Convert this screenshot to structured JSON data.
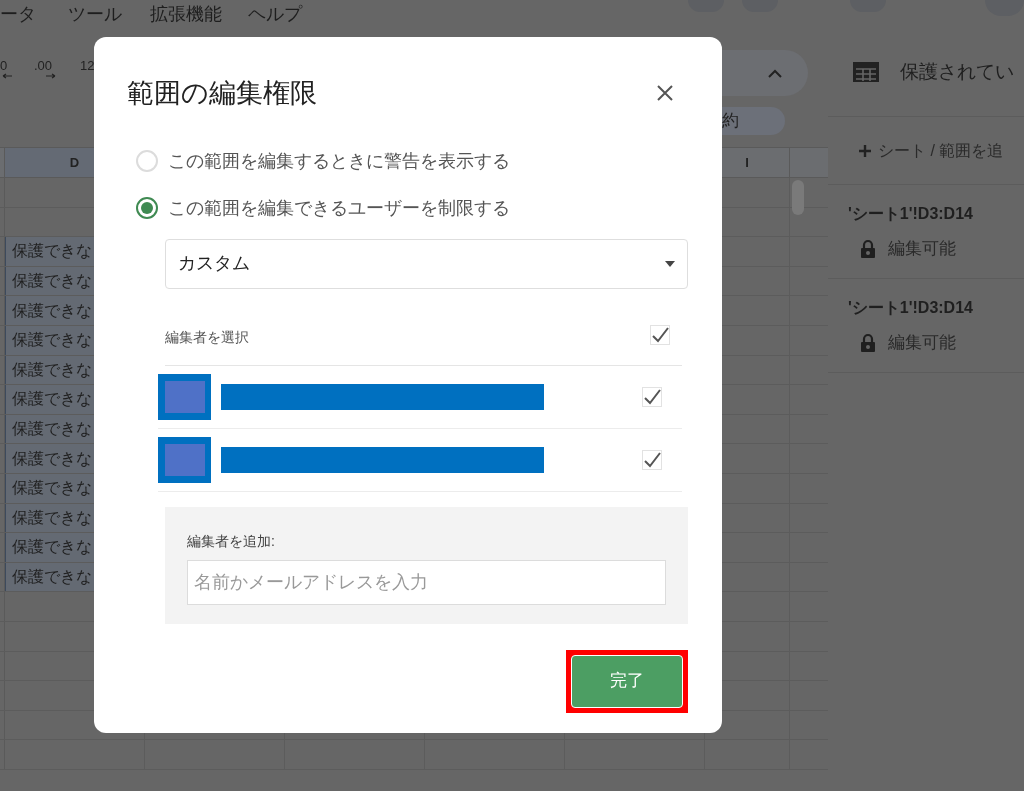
{
  "menu": [
    "ータ",
    "ツール",
    "拡張機能",
    "ヘルプ"
  ],
  "toolbar": {
    "items": [
      "0",
      ".00",
      "12"
    ],
    "summary": "約"
  },
  "sheet": {
    "columns": [
      {
        "label": "D"
      },
      {},
      {},
      {},
      {},
      {
        "label": "I"
      }
    ],
    "cells": [
      "保護できな",
      "保護できな",
      "保護できな",
      "保護できな",
      "保護できな",
      "保護できな",
      "保護できな",
      "保護できな",
      "保護できな",
      "保護できな",
      "保護できな",
      "保護できな"
    ]
  },
  "panel": {
    "title": "保護されてい",
    "add_label": "シート / 範囲を追",
    "ranges": [
      {
        "range": "'シート1'!D3:D14",
        "permission": "編集可能"
      },
      {
        "range": "'シート1'!D3:D14",
        "permission": "編集可能"
      }
    ]
  },
  "dialog": {
    "title": "範囲の編集権限",
    "options": [
      {
        "label": "この範囲を編集するときに警告を表示する",
        "selected": false
      },
      {
        "label": "この範囲を編集できるユーザーを制限する",
        "selected": true
      }
    ],
    "dropdown": {
      "value": "カスタム"
    },
    "select_editors": {
      "label": "編集者を選択",
      "checked": true
    },
    "editors": [
      {
        "checked": true
      },
      {
        "checked": true
      }
    ],
    "add_editor": {
      "label": "編集者を追加:",
      "placeholder": "名前かメールアドレスを入力"
    },
    "done_button": {
      "label": "完了",
      "highlighted": true
    }
  }
}
